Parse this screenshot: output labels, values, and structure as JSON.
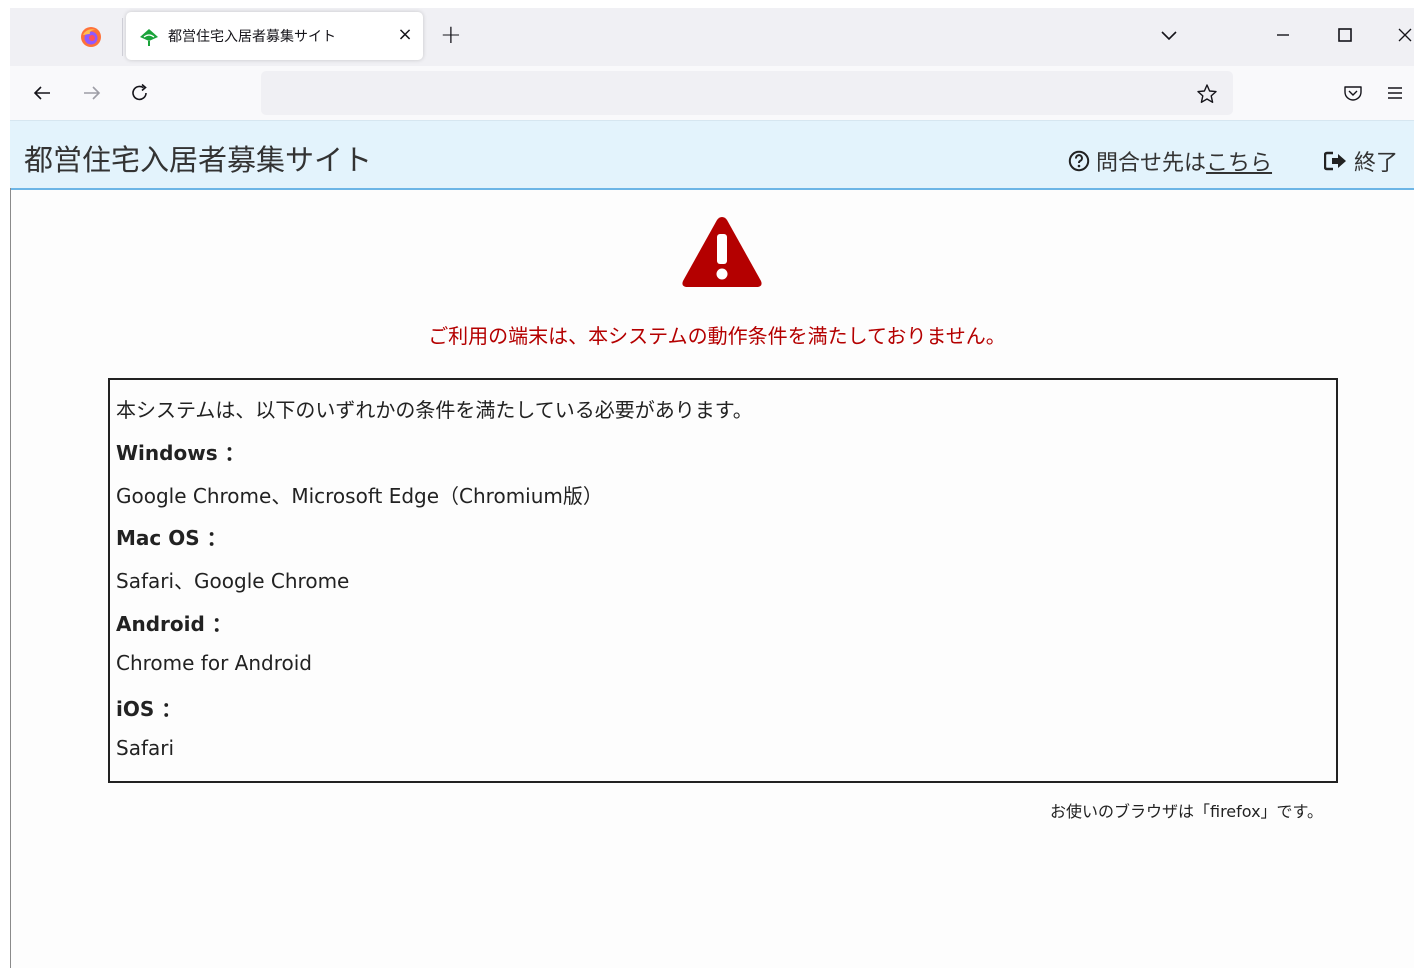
{
  "browser": {
    "tab": {
      "title": "都営住宅入居者募集サイト",
      "close_glyph": "×"
    },
    "new_tab_glyph": "+",
    "url": "",
    "icons": {
      "firefox": "firefox-icon",
      "favicon": "tokyo-ginkgo-icon",
      "tablist": "chevron-down-icon",
      "back": "arrow-left-icon",
      "forward": "arrow-right-icon",
      "reload": "reload-icon",
      "bookmark": "star-icon",
      "pocket": "pocket-icon",
      "menu": "hamburger-icon",
      "minimize": "minimize-icon",
      "maximize": "maximize-icon",
      "close": "close-icon"
    }
  },
  "header": {
    "title": "都営住宅入居者募集サイト",
    "contact_prefix": "問合せ先は",
    "contact_link": "こちら",
    "logout_label": "終了",
    "accent_color": "#6cb5e6",
    "background_color": "#e3f3fc"
  },
  "main": {
    "error_message": "ご利用の端末は、本システムの動作条件を満たしておりません。",
    "error_color": "#b40000",
    "requirements": {
      "intro": "本システムは、以下のいずれかの条件を満たしている必要があります。",
      "platforms": [
        {
          "os": "Windows ：",
          "browsers": "Google Chrome、Microsoft Edge（Chromium版）"
        },
        {
          "os": "Mac OS ：",
          "browsers": "Safari、Google Chrome"
        },
        {
          "os": "Android ：",
          "browsers": "Chrome for Android"
        },
        {
          "os": "iOS ：",
          "browsers": "Safari"
        }
      ]
    },
    "browser_note": "お使いのブラウザは「firefox」です。"
  }
}
